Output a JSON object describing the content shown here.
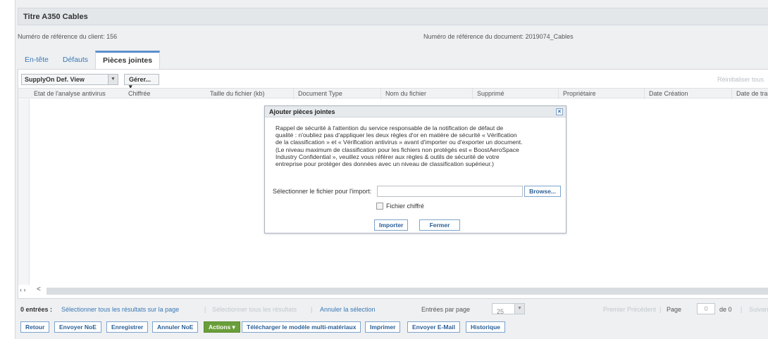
{
  "header": {
    "title": "Titre A350 Cables"
  },
  "refs": {
    "client": "Numéro de référence du client: 156",
    "document": "Numéro de référence du document: 2019074_Cables"
  },
  "tabs": [
    {
      "label": "En-tête"
    },
    {
      "label": "Défauts"
    },
    {
      "label": "Pièces jointes",
      "active": true
    }
  ],
  "toolbar": {
    "view_select": "SupplyOn Def. View",
    "manage_label": "Gérer... ▾",
    "reset_label": "Réinitialiser tous"
  },
  "table": {
    "columns": [
      "Etat de l'analyse antivirus",
      "Chiffrée",
      "Taille du fichier (kb)",
      "Document Type",
      "Nom du fichier",
      "Supprimé",
      "Propriétaire",
      "Date Création",
      "Date de tra"
    ],
    "rows": []
  },
  "scroll": {
    "nav": "‹ ›",
    "left": "<"
  },
  "status": {
    "count": "0 entrées :",
    "select_page": "Sélectionner tous les résultats sur la page",
    "sep1": "|",
    "select_all": "Sélectionner tous les résultats",
    "sep2": "|",
    "clear": "Annuler la sélection",
    "per_page_label": "Entrées par page",
    "per_page_value": "25",
    "first": "Premier",
    "prev": "Précédent",
    "sep3": "|",
    "page_label": "Page",
    "page_value": "0",
    "page_of": "de 0",
    "sep4": "|",
    "next": "Suivant"
  },
  "actions": [
    {
      "label": "Retour"
    },
    {
      "label": "Envoyer NoE"
    },
    {
      "label": "Enregistrer"
    },
    {
      "label": "Annuler NoE"
    },
    {
      "label": "Actions ▾",
      "style": "green"
    },
    {
      "label": "Télécharger le modèle multi-matériaux"
    },
    {
      "label": "Imprimer"
    },
    {
      "label": "Envoyer E-Mail"
    },
    {
      "label": "Historique"
    }
  ],
  "modal": {
    "title": "Ajouter pièces jointes",
    "close": "×",
    "message_lines": [
      "Rappel de sécurité à l'attention du service responsable de la notification de défaut de",
      "qualité : n'oubliez pas d'appliquer les deux règles d'or en matière de sécurité « Vérification",
      "de la classification » et « Vérification antivirus » avant d'importer ou d'exporter un document.",
      "(Le niveau maximum de classification pour les fichiers non protégés est « BoostAeroSpace",
      "Industry Confidential », veuillez vous référer aux règles & outils de sécurité de votre",
      "entreprise pour protéger des données avec un niveau de classification supérieur.)"
    ],
    "file_label": "Sélectionner le fichier pour l'import:",
    "file_value": "",
    "browse": "Browse...",
    "checkbox_label": "Fichier chiffré",
    "import": "Importer",
    "close_btn": "Fermer"
  }
}
